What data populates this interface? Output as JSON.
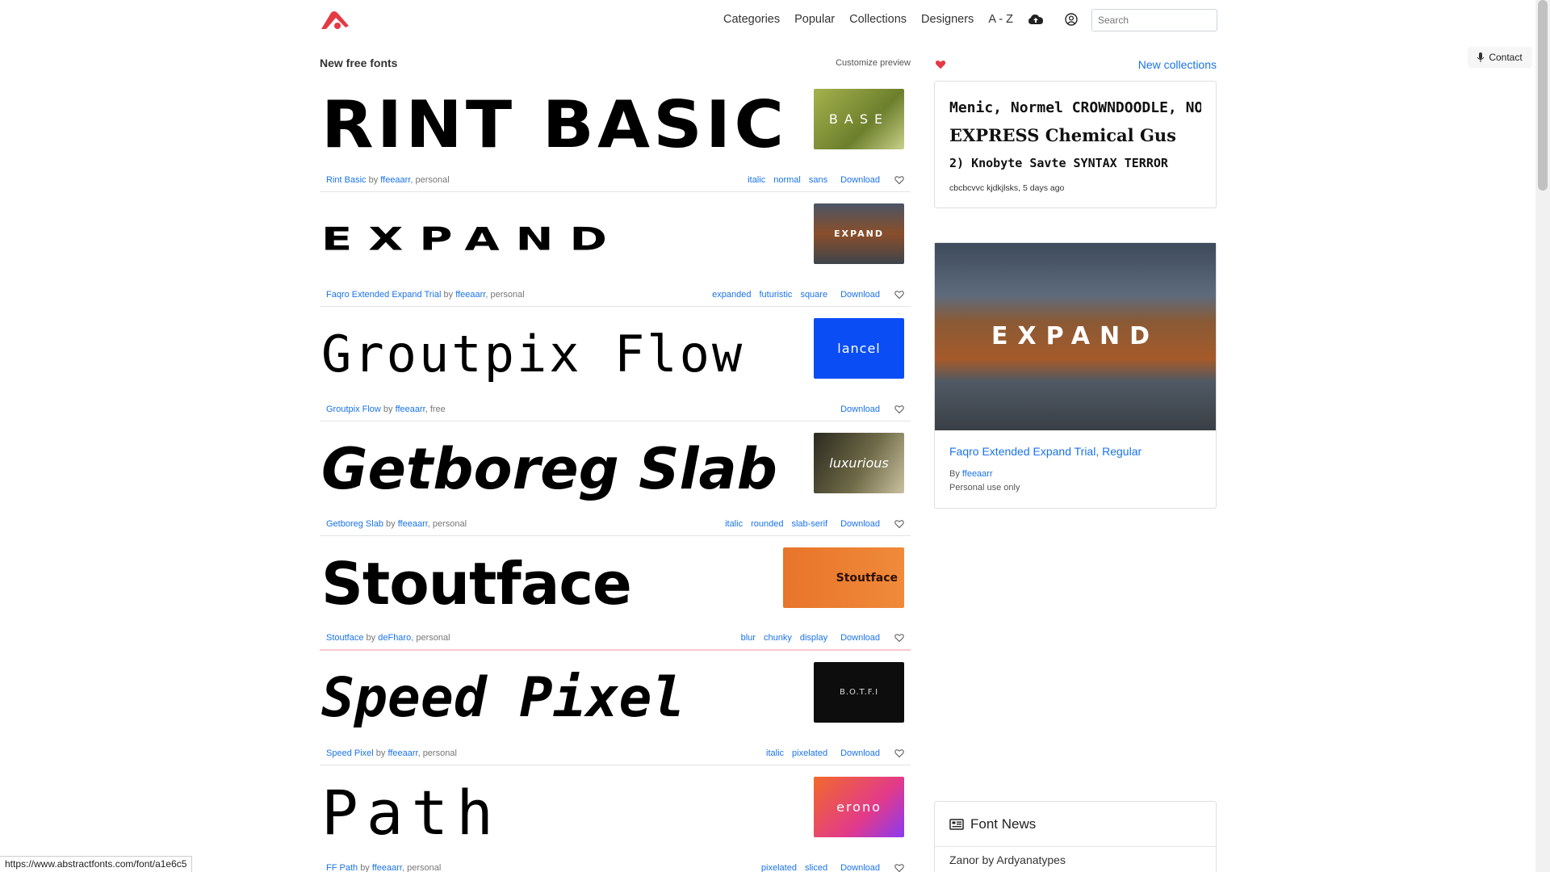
{
  "header": {
    "nav": [
      "Categories",
      "Popular",
      "Collections",
      "Designers",
      "A - Z"
    ],
    "search_placeholder": "Search"
  },
  "contact_label": "Contact",
  "main": {
    "title": "New free fonts",
    "customize": "Customize preview",
    "fonts": [
      {
        "preview": "RINT BASIC",
        "name": "Rint Basic",
        "by": "by",
        "designer": "ffeeaarr",
        "license": ", personal",
        "tags": [
          "italic",
          "normal",
          "sans"
        ],
        "thumb_text": "BASE"
      },
      {
        "preview": "EXPAND",
        "name": "Faqro Extended Expand Trial",
        "by": "by",
        "designer": "ffeeaarr",
        "license": ", personal",
        "tags": [
          "expanded",
          "futuristic",
          "square"
        ],
        "thumb_text": "EXPAND"
      },
      {
        "preview": "Groutpix Flow",
        "name": "Groutpix Flow",
        "by": "by",
        "designer": "ffeeaarr",
        "license": ", free",
        "tags": [],
        "thumb_text": "lancel"
      },
      {
        "preview": "Getboreg Slab",
        "name": "Getboreg Slab",
        "by": "by",
        "designer": "ffeeaarr",
        "license": ", personal",
        "tags": [
          "italic",
          "rounded",
          "slab-serif"
        ],
        "thumb_text": "luxurious"
      },
      {
        "preview": "Stoutface",
        "name": "Stoutface",
        "by": "by",
        "designer": "deFharo",
        "license": ", personal",
        "tags": [
          "blur",
          "chunky",
          "display"
        ],
        "thumb_text": "Stoutface"
      },
      {
        "preview": "Speed Pixel",
        "name": "Speed Pixel",
        "by": "by",
        "designer": "ffeeaarr",
        "license": ", personal",
        "tags": [
          "italic",
          "pixelated"
        ],
        "thumb_text": "B.O.T.F.I"
      },
      {
        "preview": "Path",
        "name": "FF Path",
        "by": "by",
        "designer": "ffeeaarr",
        "license": ", personal",
        "tags": [
          "pixelated",
          "sliced"
        ],
        "thumb_text": "erono"
      }
    ],
    "download": "Download"
  },
  "right": {
    "new_collections": "New collections",
    "collection": {
      "lines": [
        "Menic, Normel  CROWNDOODLE, NORMAL",
        "EXPRESS Chemical Gus",
        "2) Knobyte Savte  SYNTAX TERROR"
      ],
      "meta": "cbcbcvvc kjdkjlsks, 5 days ago"
    },
    "featured": {
      "title": "Faqro Extended Expand Trial, Regular",
      "by_label": "By",
      "designer": "ffeeaarr",
      "use": "Personal use only",
      "img_text": "EXPAND"
    },
    "news": {
      "title": "Font News",
      "item": "Zanor by Ardyanatypes"
    }
  },
  "status_url": "https://www.abstractfonts.com/font/a1e6c5",
  "colors": {
    "link": "#1a73e8",
    "heart": "#e53945",
    "logo": "#e53945"
  }
}
